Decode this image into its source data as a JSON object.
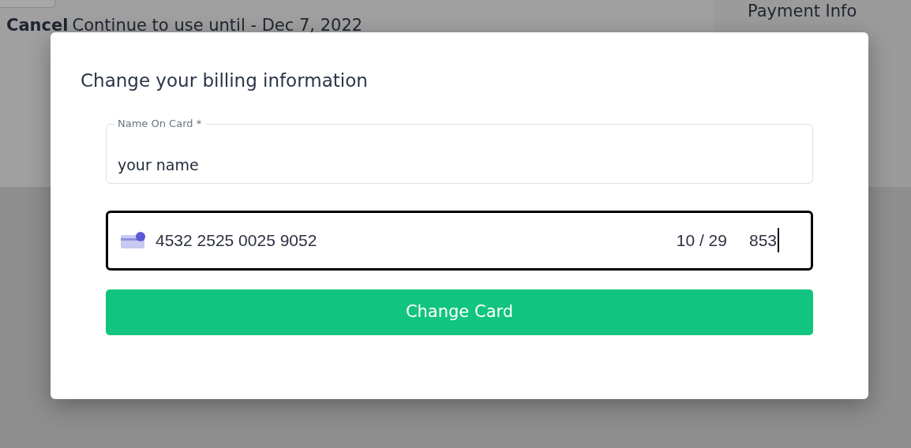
{
  "background": {
    "cancel_label": "Cancel",
    "renewal_note": "Continue to use until - Dec 7, 2022",
    "sidebar_title": "Payment Info"
  },
  "modal": {
    "title": "Change your billing information",
    "name_field": {
      "label": "Name On Card *",
      "value": "your name"
    },
    "card_field": {
      "number": "4532 2525 0025 9052",
      "expiry": "10 / 29",
      "cvc": "853",
      "focused": true
    },
    "submit": "Change Card"
  }
}
